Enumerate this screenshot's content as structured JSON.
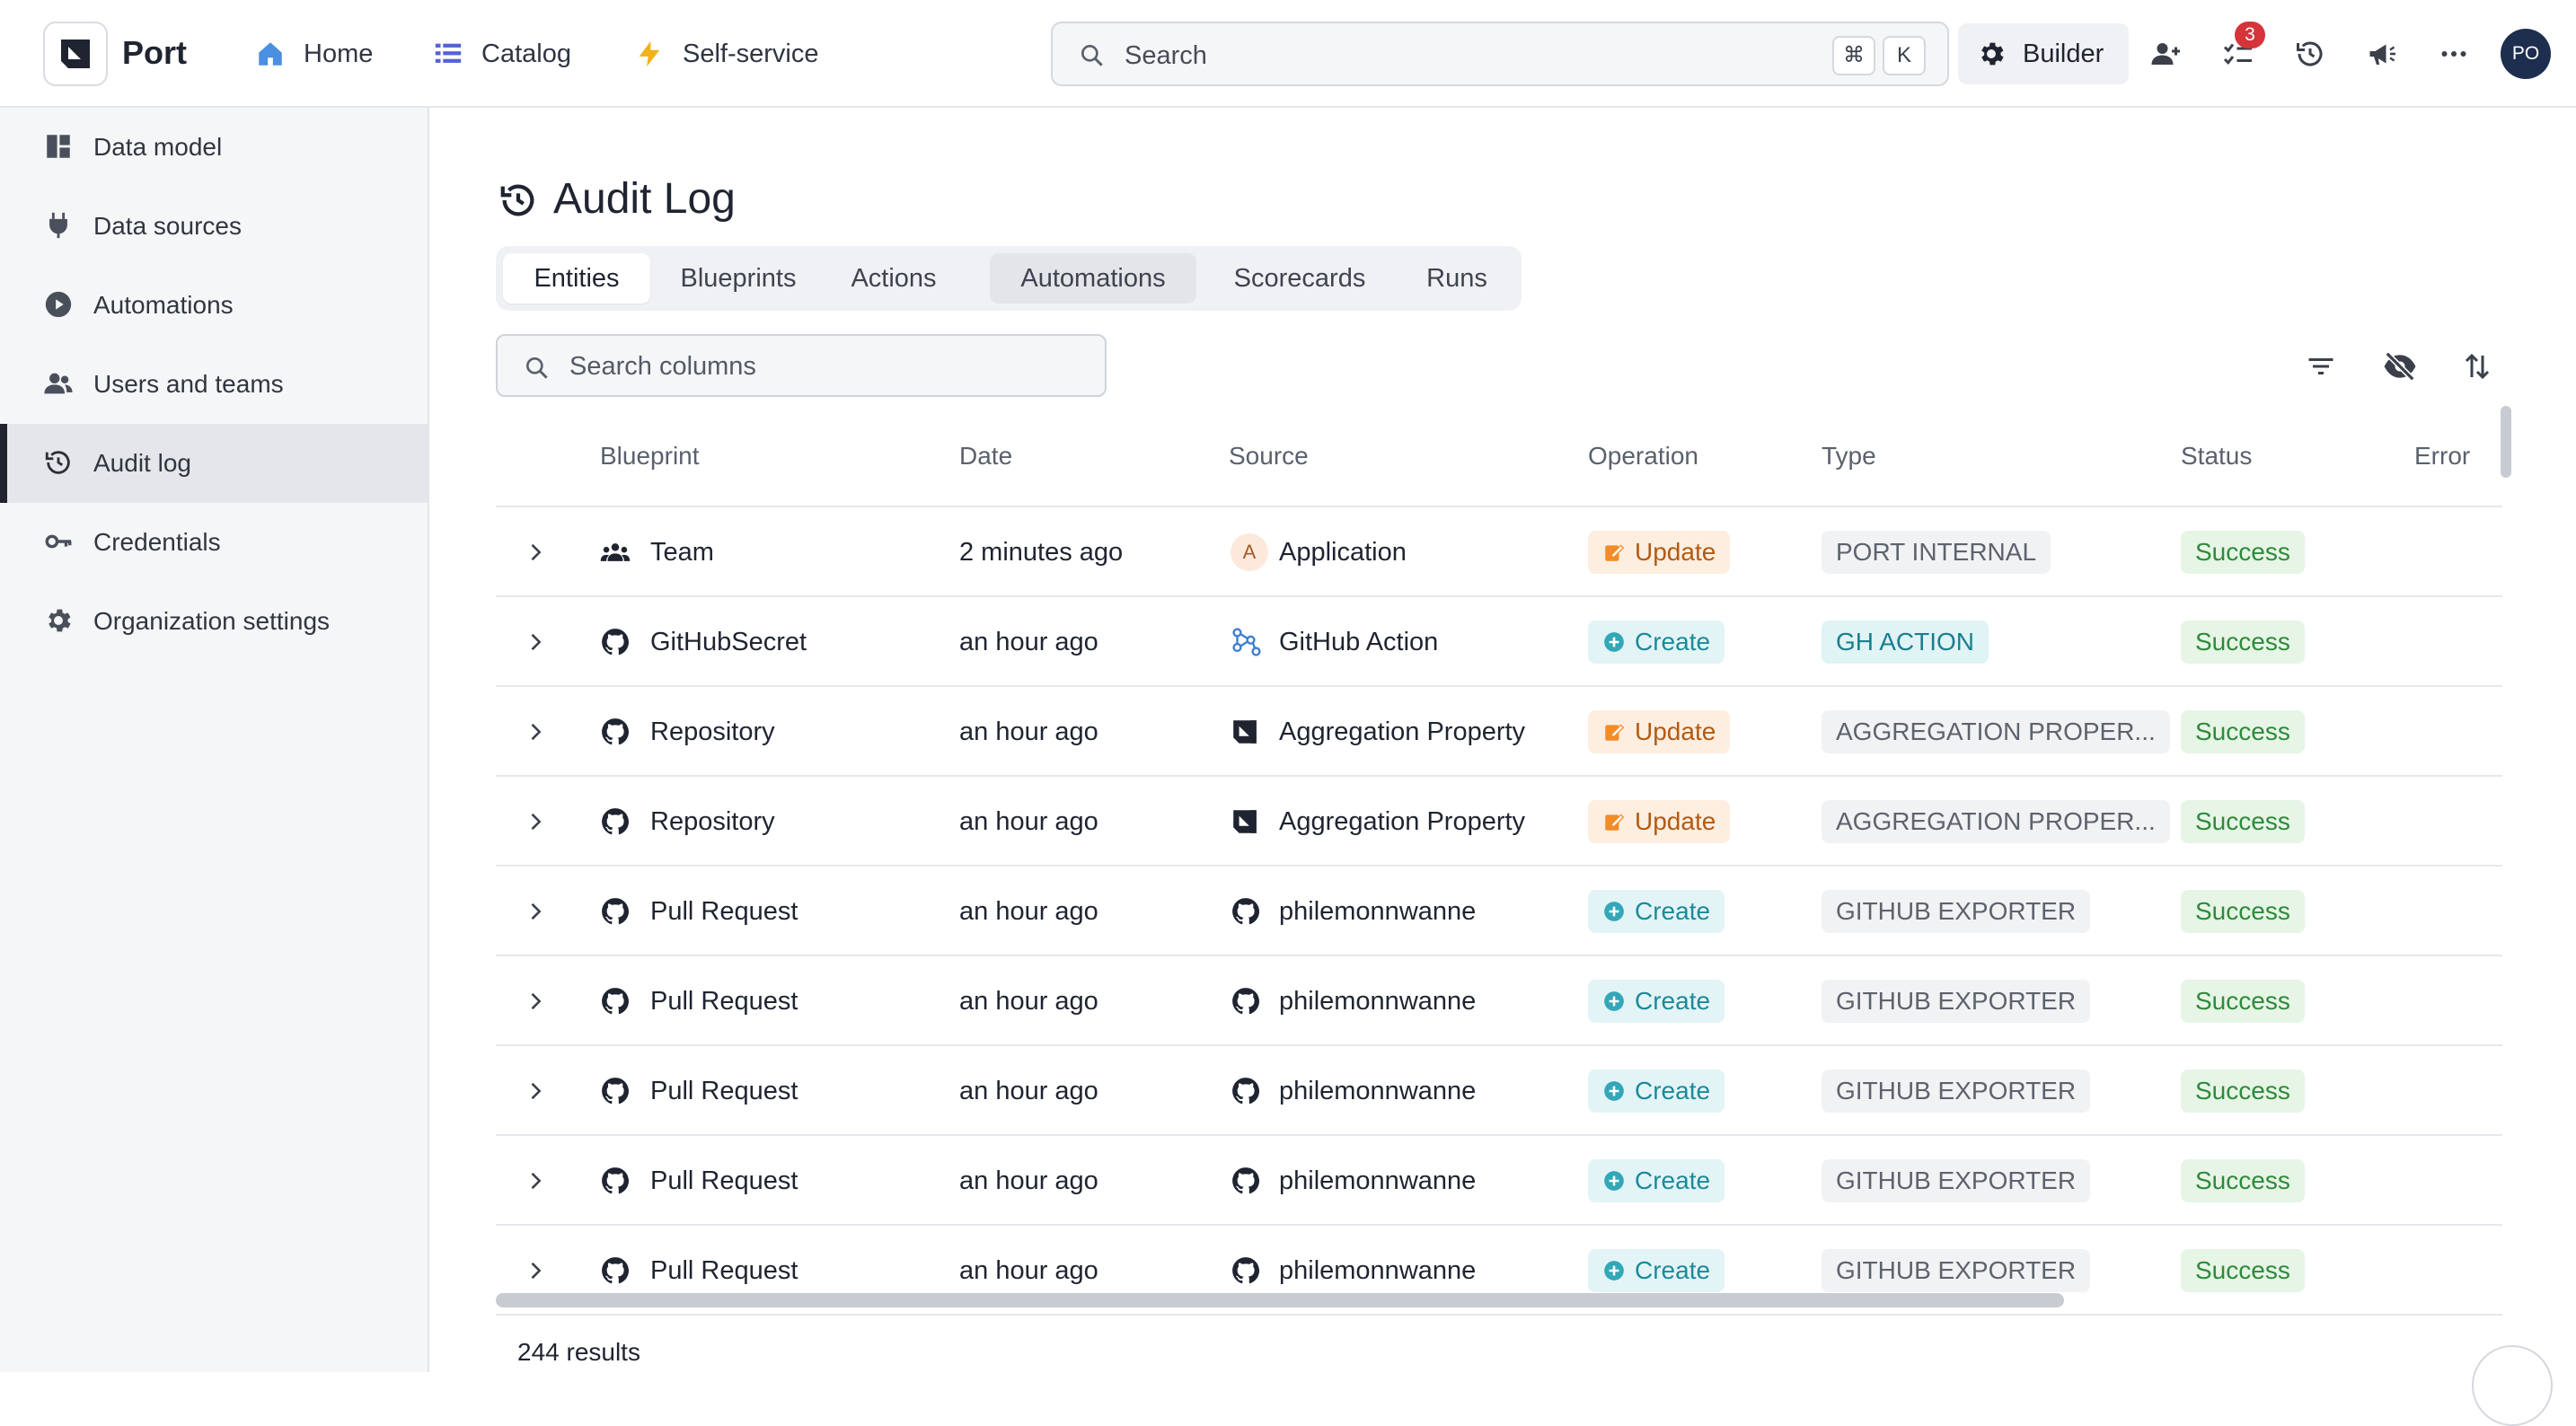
{
  "topbar": {
    "brand": "Port",
    "nav": [
      {
        "label": "Home",
        "icon": "home-icon"
      },
      {
        "label": "Catalog",
        "icon": "catalog-list-icon"
      },
      {
        "label": "Self-service",
        "icon": "lightning-icon"
      }
    ],
    "search": {
      "placeholder": "Search",
      "shortcut_keys": [
        "⌘",
        "K"
      ]
    },
    "builder_label": "Builder",
    "notification_count": "3",
    "avatar_initials": "PO"
  },
  "sidebar": {
    "items": [
      {
        "label": "Data model",
        "icon": "data-model-icon"
      },
      {
        "label": "Data sources",
        "icon": "plug-icon"
      },
      {
        "label": "Automations",
        "icon": "play-circle-icon"
      },
      {
        "label": "Users and teams",
        "icon": "users-icon"
      },
      {
        "label": "Audit log",
        "icon": "history-icon",
        "active": true
      },
      {
        "label": "Credentials",
        "icon": "key-icon"
      },
      {
        "label": "Organization settings",
        "icon": "gear-icon"
      }
    ]
  },
  "main": {
    "title": "Audit Log",
    "tabs": [
      {
        "label": "Entities",
        "active": true
      },
      {
        "label": "Blueprints"
      },
      {
        "label": "Actions"
      },
      {
        "label": "Automations",
        "hovered": true
      },
      {
        "label": "Scorecards"
      },
      {
        "label": "Runs"
      }
    ],
    "column_search_placeholder": "Search columns",
    "table": {
      "columns": [
        "Blueprint",
        "Date",
        "Source",
        "Operation",
        "Type",
        "Status",
        "Error"
      ],
      "rows": [
        {
          "blueprint": "Team",
          "blueprint_icon": "team-icon",
          "date": "2 minutes ago",
          "source": "Application",
          "source_icon": "application-avatar",
          "source_initial": "A",
          "operation": "Update",
          "type": "PORT INTERNAL",
          "status": "Success"
        },
        {
          "blueprint": "GitHubSecret",
          "blueprint_icon": "github-icon",
          "date": "an hour ago",
          "source": "GitHub Action",
          "source_icon": "github-action-icon",
          "operation": "Create",
          "type": "GH ACTION",
          "status": "Success"
        },
        {
          "blueprint": "Repository",
          "blueprint_icon": "github-icon",
          "date": "an hour ago",
          "source": "Aggregation Property",
          "source_icon": "port-logo-icon",
          "operation": "Update",
          "type": "AGGREGATION PROPER...",
          "status": "Success"
        },
        {
          "blueprint": "Repository",
          "blueprint_icon": "github-icon",
          "date": "an hour ago",
          "source": "Aggregation Property",
          "source_icon": "port-logo-icon",
          "operation": "Update",
          "type": "AGGREGATION PROPER...",
          "status": "Success"
        },
        {
          "blueprint": "Pull Request",
          "blueprint_icon": "github-icon",
          "date": "an hour ago",
          "source": "philemonnwanne",
          "source_icon": "github-icon",
          "operation": "Create",
          "type": "GITHUB EXPORTER",
          "status": "Success"
        },
        {
          "blueprint": "Pull Request",
          "blueprint_icon": "github-icon",
          "date": "an hour ago",
          "source": "philemonnwanne",
          "source_icon": "github-icon",
          "operation": "Create",
          "type": "GITHUB EXPORTER",
          "status": "Success"
        },
        {
          "blueprint": "Pull Request",
          "blueprint_icon": "github-icon",
          "date": "an hour ago",
          "source": "philemonnwanne",
          "source_icon": "github-icon",
          "operation": "Create",
          "type": "GITHUB EXPORTER",
          "status": "Success"
        },
        {
          "blueprint": "Pull Request",
          "blueprint_icon": "github-icon",
          "date": "an hour ago",
          "source": "philemonnwanne",
          "source_icon": "github-icon",
          "operation": "Create",
          "type": "GITHUB EXPORTER",
          "status": "Success"
        },
        {
          "blueprint": "Pull Request",
          "blueprint_icon": "github-icon",
          "date": "an hour ago",
          "source": "philemonnwanne",
          "source_icon": "github-icon",
          "operation": "Create",
          "type": "GITHUB EXPORTER",
          "status": "Success"
        }
      ]
    },
    "results_text": "244 results"
  },
  "colors": {
    "update_bg": "#fdeee0",
    "update_fg": "#b35a12",
    "create_bg": "#e3f4f6",
    "create_fg": "#1b8a9a",
    "success_bg": "#e6f5e6",
    "success_fg": "#2f8a3b",
    "badge": "#d6343b",
    "avatar_bg": "#1d2e4f"
  }
}
